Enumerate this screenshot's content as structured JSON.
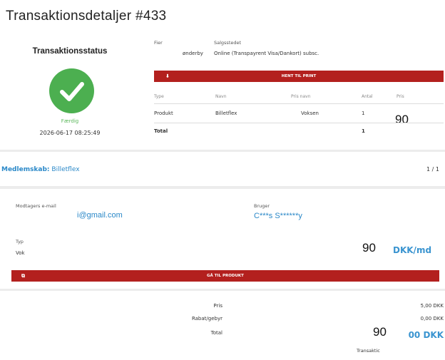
{
  "title": "Transaktionsdetaljer #433",
  "status": {
    "heading": "Transaktionsstatus",
    "text": "Færdig",
    "date": "2026-06-17 08:25:49"
  },
  "info": {
    "label1": "Fier",
    "value1": "ønderby",
    "label2": "Salgsstedet",
    "value2": "Online (Transpayrent Visa/Dankort) subsc.",
    "print_button": "HENT TIL PRINT",
    "print_icon": "download-icon"
  },
  "table": {
    "headers": [
      "Type",
      "Navn",
      "Pris navn",
      "Antal",
      "Pris"
    ],
    "rows": [
      {
        "type": "Produkt",
        "name": "Billetflex",
        "price_name": "Voksen",
        "count": "1"
      }
    ],
    "total_label": "Total",
    "total_count": "1",
    "overlay_value": "90"
  },
  "membership": {
    "label": "Medlemskab:",
    "name": "Billetflex",
    "count": "1 / 1"
  },
  "detail": {
    "email_label": "Modtagers e-mail",
    "email_value": "i@gmail.com",
    "user_label": "Bruger",
    "user_value": "C***s S******y",
    "type_label": "Typ",
    "type_value": "Vok",
    "overlay_value": "90",
    "price_unit": "DKK/md",
    "product_button": "GÅ TIL PRODUKT",
    "product_icon": "external-link-icon"
  },
  "totals": {
    "price_label": "Pris",
    "price_value": "5,00 DKK",
    "fee_label": "Rabat/gebyr",
    "fee_value": "0,00 DKK",
    "total_label": "Total",
    "total_value": "00 DKK",
    "overlay_value": "90",
    "transaction_label": "Transaktic"
  }
}
